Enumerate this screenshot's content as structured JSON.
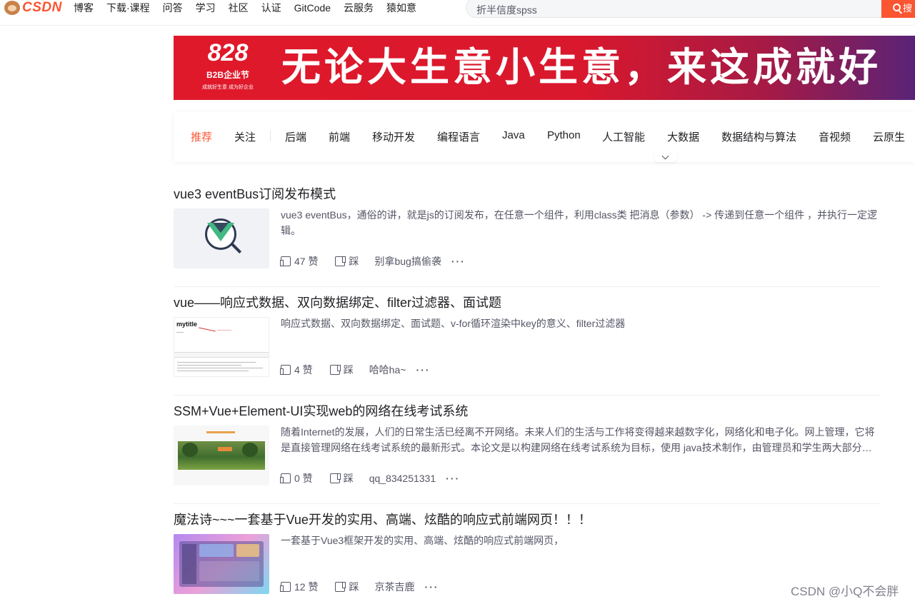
{
  "nav": {
    "logo": "CSDN",
    "links": [
      "博客",
      "下载·课程",
      "问答",
      "学习",
      "社区",
      "认证",
      "GitCode",
      "云服务",
      "猿如意"
    ],
    "search_value": "折半信度spss",
    "search_button": "搜"
  },
  "banner": {
    "badge_number": "828",
    "badge_title": "B2B企业节",
    "badge_sub": "成就好生意 成为好企业",
    "slogan": "无论大生意小生意，来这成就好"
  },
  "categories": {
    "active": "推荐",
    "items": [
      "推荐",
      "关注",
      "后端",
      "前端",
      "移动开发",
      "编程语言",
      "Java",
      "Python",
      "人工智能",
      "大数据",
      "数据结构与算法",
      "音视频",
      "云原生"
    ]
  },
  "articles": [
    {
      "title": "vue3 eventBus订阅发布模式",
      "description": "vue3 eventBus，通俗的讲，就是js的订阅发布，在任意一个组件，利用class类 把消息（参数） -> 传递到任意一个组件 ，并执行一定逻辑。",
      "likes": "47 赞",
      "dislike": "踩",
      "author": "别拿bug搞偷袭",
      "more": "···"
    },
    {
      "title": "vue——响应式数据、双向数据绑定、filter过滤器、面试题",
      "description": "响应式数据、双向数据绑定、面试题、v-for循环渲染中key的意义、filter过滤器",
      "likes": "4 赞",
      "dislike": "踩",
      "author": "哈哈ha~",
      "more": "···",
      "thumb_text": "mytitle"
    },
    {
      "title": "SSM+Vue+Element-UI实现web的网络在线考试系统",
      "description": "随着Internet的发展，人们的日常生活已经离不开网络。未来人们的生活与工作将变得越来越数字化，网络化和电子化。网上管理，它将是直接管理网络在线考试系统的最新形式。本论文是以构建网络在线考试系统为目标，使用 java技术制作，由管理员和学生两大部分…",
      "likes": "0 赞",
      "dislike": "踩",
      "author": "qq_834251331",
      "more": "···"
    },
    {
      "title": "魔法诗~~~一套基于Vue开发的实用、高端、炫酷的响应式前端网页！！！",
      "description": "一套基于Vue3框架开发的实用、高端、炫酷的响应式前端网页，",
      "likes": "12 赞",
      "dislike": "踩",
      "author": "京茶吉鹿",
      "more": "···"
    }
  ],
  "watermark": "CSDN @小Q不会胖",
  "colors": {
    "accent": "#fc5531",
    "text": "#222226",
    "muted": "#555666"
  }
}
